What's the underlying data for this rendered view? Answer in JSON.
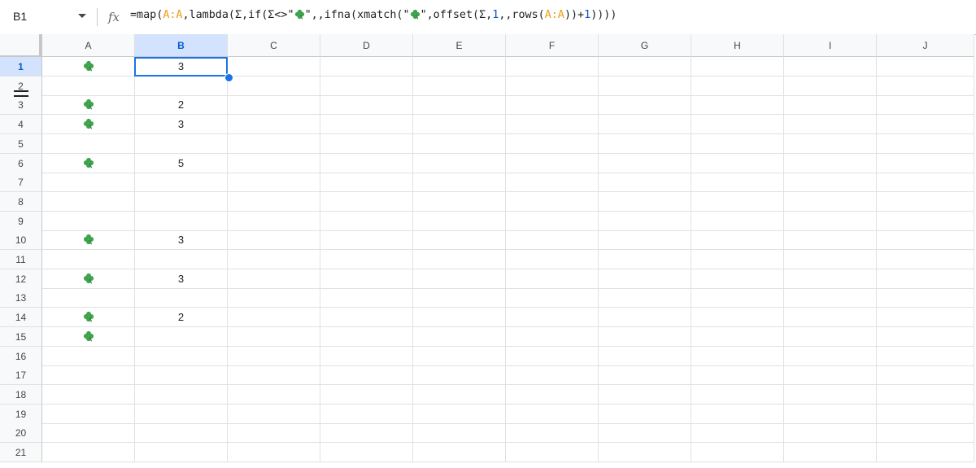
{
  "name_box": {
    "value": "B1"
  },
  "formula_bar": {
    "icon": "fx-icon",
    "parts": [
      {
        "t": "=map(",
        "k": "plain"
      },
      {
        "t": "A:A",
        "k": "ref"
      },
      {
        "t": ",lambda(Σ,if(Σ<>\"",
        "k": "plain"
      },
      {
        "t": "🍀",
        "k": "clover"
      },
      {
        "t": "\",,ifna(xmatch(\"",
        "k": "plain"
      },
      {
        "t": "🍀",
        "k": "clover"
      },
      {
        "t": "\",offset(Σ,",
        "k": "plain"
      },
      {
        "t": "1",
        "k": "num"
      },
      {
        "t": ",,rows(",
        "k": "plain"
      },
      {
        "t": "A:A",
        "k": "ref"
      },
      {
        "t": "))+",
        "k": "plain"
      },
      {
        "t": "1",
        "k": "num"
      },
      {
        "t": "))))",
        "k": "plain"
      }
    ]
  },
  "columns": [
    "A",
    "B",
    "C",
    "D",
    "E",
    "F",
    "G",
    "H",
    "I",
    "J"
  ],
  "active_column": "B",
  "rows": [
    "1",
    "2",
    "3",
    "4",
    "5",
    "6",
    "7",
    "8",
    "9",
    "10",
    "11",
    "12",
    "13",
    "14",
    "15",
    "16",
    "17",
    "18",
    "19",
    "20",
    "21"
  ],
  "active_row": "1",
  "column_a": [
    "🍀",
    "",
    "🍀",
    "🍀",
    "",
    "🍀",
    "",
    "",
    "",
    "🍀",
    "",
    "🍀",
    "",
    "🍀",
    "🍀",
    "",
    "",
    "",
    "",
    "",
    ""
  ],
  "column_b": [
    "3",
    "",
    "2",
    "3",
    "",
    "5",
    "",
    "",
    "",
    "3",
    "",
    "3",
    "",
    "2",
    "",
    "",
    "",
    "",
    "",
    "",
    ""
  ],
  "icons": {
    "clover": "four-leaf-clover-icon",
    "dropdown": "chevron-down-icon"
  },
  "colors": {
    "selection": "#1a73e8",
    "reference": "#e8a117",
    "number": "#1155cc",
    "header_active": "#d3e3fd"
  }
}
